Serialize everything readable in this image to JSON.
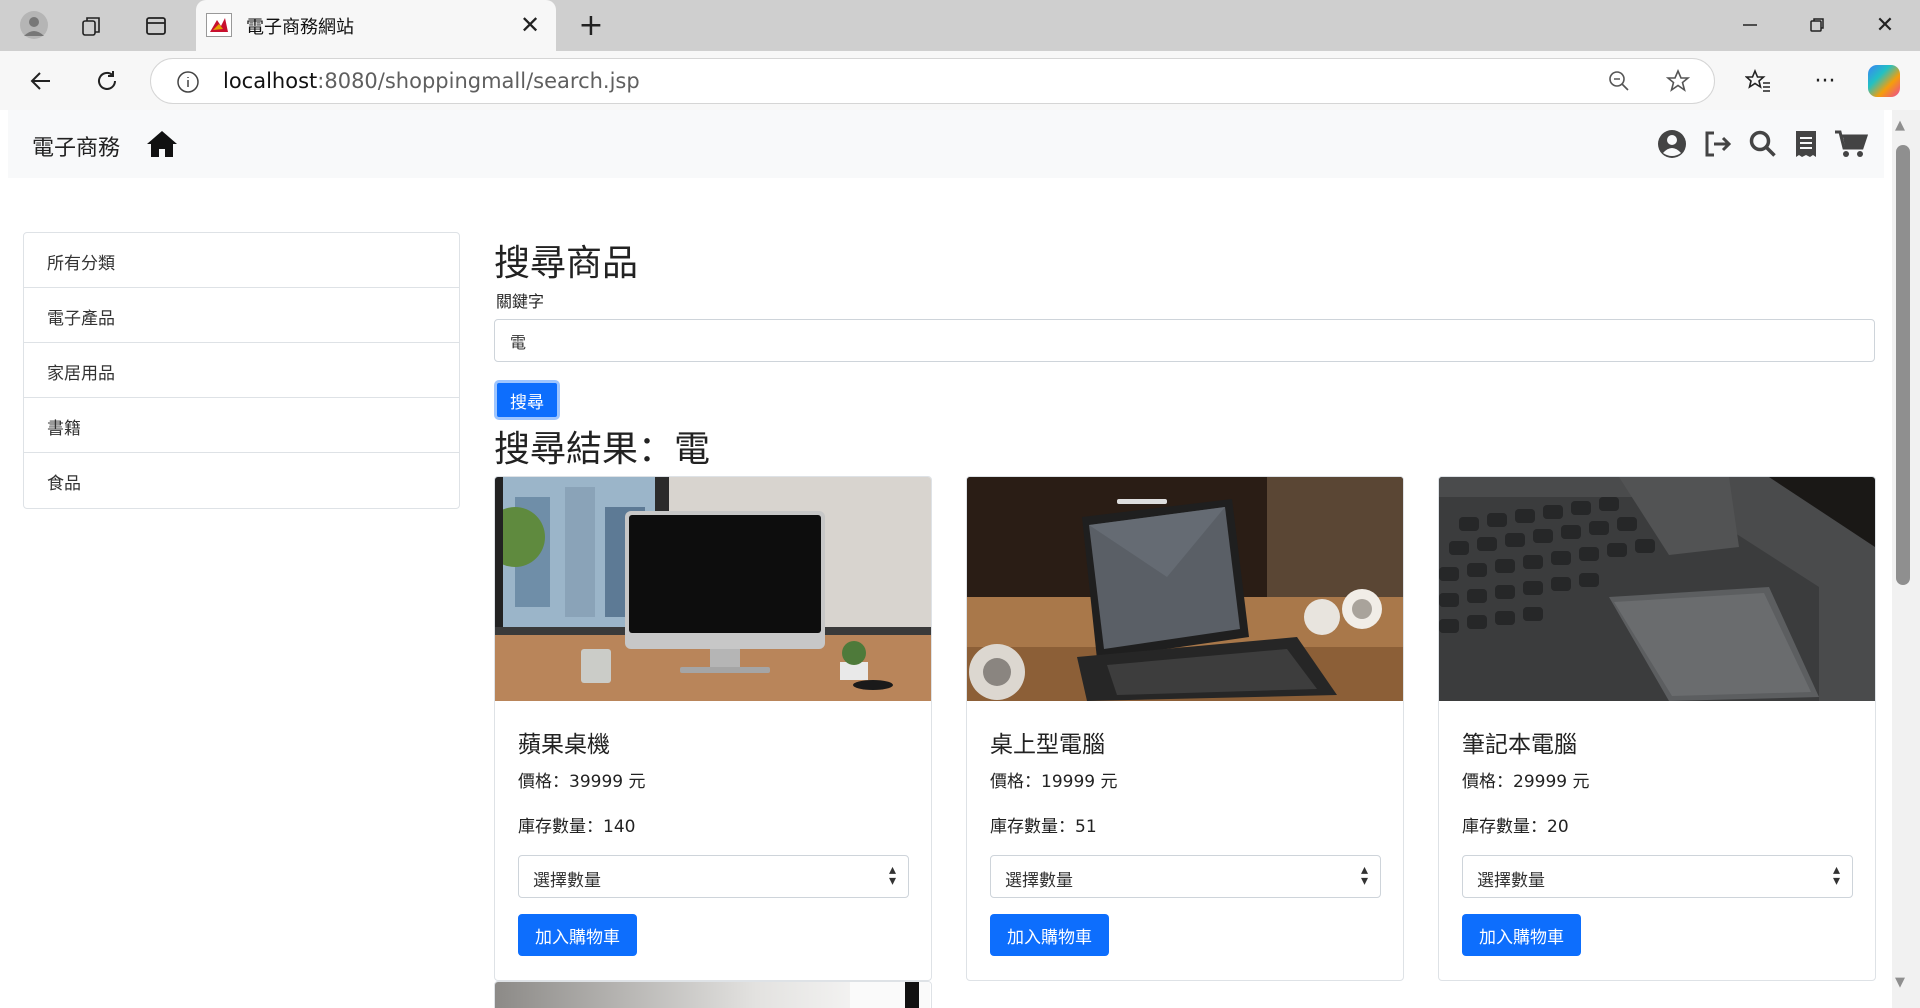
{
  "browser": {
    "tab_title": "電子商務網站",
    "url_host": "localhost",
    "url_path": ":8080/shoppingmall/search.jsp"
  },
  "navbar": {
    "brand": "電子商務",
    "icons": [
      "home-icon",
      "user-circle-icon",
      "sign-out-icon",
      "search-icon",
      "receipt-icon",
      "shopping-cart-icon"
    ]
  },
  "sidebar": {
    "items": [
      {
        "label": "所有分類"
      },
      {
        "label": "電子產品"
      },
      {
        "label": "家居用品"
      },
      {
        "label": "書籍"
      },
      {
        "label": "食品"
      }
    ]
  },
  "search": {
    "heading": "搜尋商品",
    "keyword_label": "關鍵字",
    "keyword_value": "電",
    "button_label": "搜尋"
  },
  "results": {
    "title": "搜尋結果：電",
    "products": [
      {
        "name": "蘋果桌機",
        "price": "價格：39999 元",
        "stock": "庫存數量：140",
        "quantity_placeholder": "選擇數量",
        "add_to_cart": "加入購物車"
      },
      {
        "name": "桌上型電腦",
        "price": "價格：19999 元",
        "stock": "庫存數量：51",
        "quantity_placeholder": "選擇數量",
        "add_to_cart": "加入購物車"
      },
      {
        "name": "筆記本電腦",
        "price": "價格：29999 元",
        "stock": "庫存數量：20",
        "quantity_placeholder": "選擇數量",
        "add_to_cart": "加入購物車"
      }
    ]
  },
  "colors": {
    "primary": "#0d6efd",
    "navbar_bg": "#f8f9fa",
    "border": "#dee2e6"
  }
}
